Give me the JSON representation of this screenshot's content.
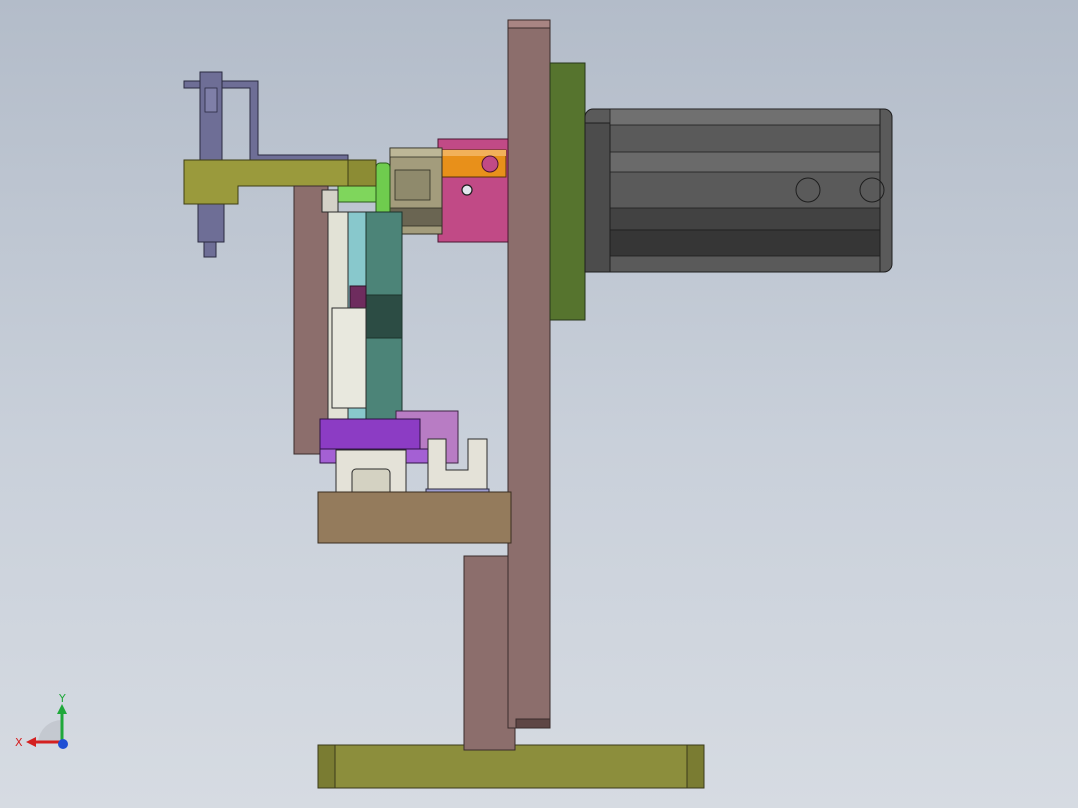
{
  "view": {
    "triad": {
      "x_label": "X",
      "y_label": "Y",
      "x_color": "#d42020",
      "y_color": "#1fa83a",
      "z_color": "#1f4fd4"
    }
  },
  "model_parts": [
    "base-plate",
    "vertical-frame-plate",
    "motor-mount-plate",
    "motor-body",
    "motor-coupling-block",
    "orange-shaft",
    "coupling-collar",
    "green-shaft",
    "yellow-arm",
    "cylinder-rod",
    "bracket-hook",
    "slide-block",
    "purple-gripper",
    "jaw-fixture",
    "tan-table",
    "support-column"
  ]
}
